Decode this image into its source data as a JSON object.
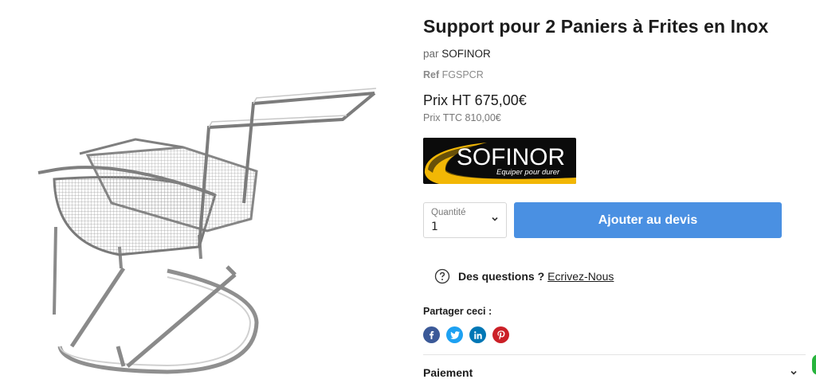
{
  "product": {
    "title": "Support pour 2 Paniers à Frites en Inox",
    "vendor_prefix": "par",
    "vendor": "SOFINOR",
    "ref_label": "Ref",
    "ref_value": "FGSPCR",
    "price_ht": "Prix HT 675,00€",
    "price_ttc": "Prix TTC 810,00€"
  },
  "brand": {
    "name": "SOFINOR",
    "tagline": "Equiper pour durer",
    "accent_color": "#f2b705"
  },
  "quantity": {
    "label": "Quantité",
    "value": "1",
    "icon": "chevron-down-icon"
  },
  "add_button": {
    "label": "Ajouter au devis",
    "color": "#4a90e2"
  },
  "questions": {
    "strong": "Des questions ?",
    "link": "Ecrivez-Nous",
    "icon": "question-circle-icon"
  },
  "share": {
    "label": "Partager ceci :",
    "buttons": [
      {
        "network": "facebook",
        "icon": "facebook-icon",
        "color": "#3b5998"
      },
      {
        "network": "twitter",
        "icon": "twitter-icon",
        "color": "#1da1f2"
      },
      {
        "network": "linkedin",
        "icon": "linkedin-icon",
        "color": "#0077b5"
      },
      {
        "network": "pinterest",
        "icon": "pinterest-icon",
        "color": "#cb2027"
      }
    ]
  },
  "accordion": {
    "payment_label": "Paiement",
    "icon": "chevron-down-icon"
  }
}
